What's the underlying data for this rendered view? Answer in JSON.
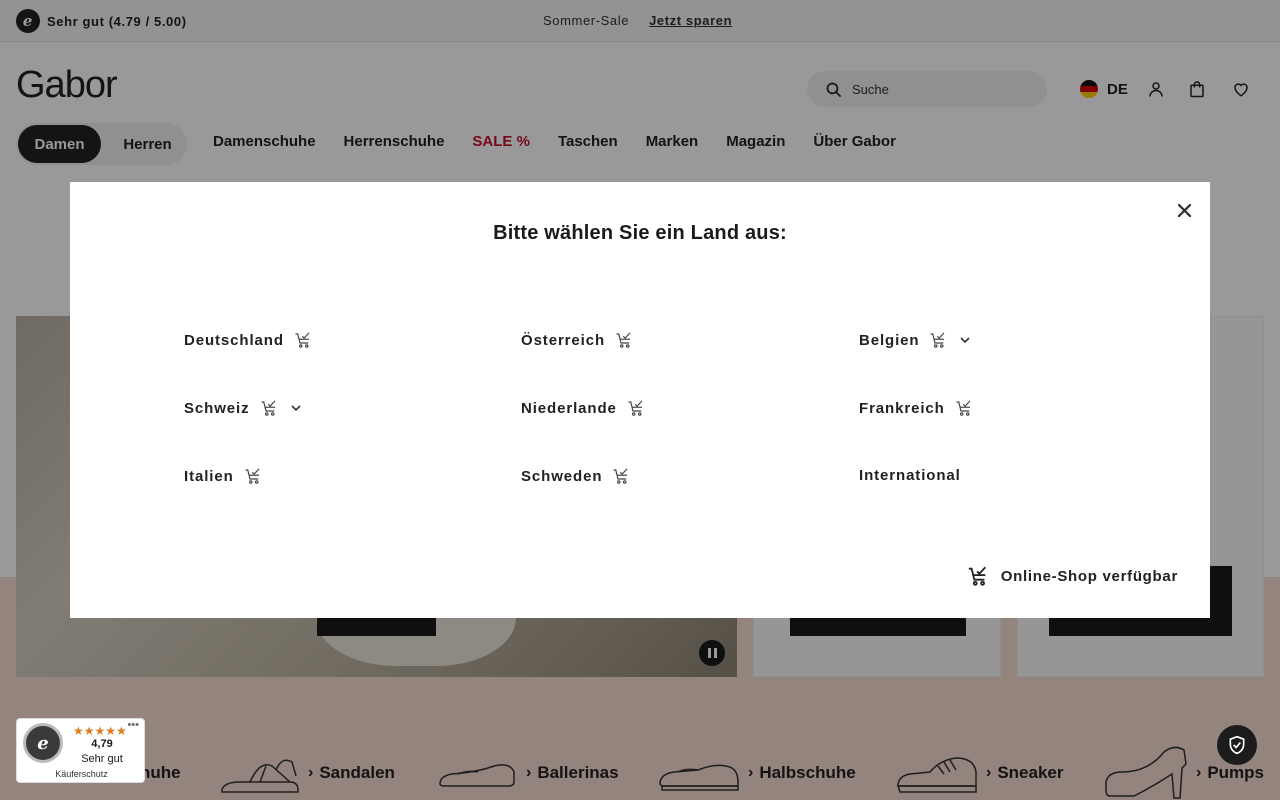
{
  "topbar": {
    "rating_text": "Sehr gut (4.79 / 5.00)",
    "promo_label": "Sommer-Sale",
    "promo_cta": "Jetzt sparen"
  },
  "header": {
    "logo": "Gabor",
    "search_placeholder": "Suche",
    "language": "DE"
  },
  "gender_toggle": {
    "active": "Damen",
    "inactive": "Herren"
  },
  "nav": {
    "items": [
      "Damenschuhe",
      "Herrenschuhe",
      "SALE %",
      "Taschen",
      "Marken",
      "Magazin",
      "Über Gabor"
    ]
  },
  "modal": {
    "title": "Bitte wählen Sie ein Land aus:",
    "countries": [
      {
        "name": "Deutschland",
        "shop": true,
        "expandable": false
      },
      {
        "name": "Österreich",
        "shop": true,
        "expandable": false
      },
      {
        "name": "Belgien",
        "shop": true,
        "expandable": true
      },
      {
        "name": "Schweiz",
        "shop": true,
        "expandable": true
      },
      {
        "name": "Niederlande",
        "shop": true,
        "expandable": false
      },
      {
        "name": "Frankreich",
        "shop": true,
        "expandable": false
      },
      {
        "name": "Italien",
        "shop": true,
        "expandable": false
      },
      {
        "name": "Schweden",
        "shop": true,
        "expandable": false
      },
      {
        "name": "International",
        "shop": false,
        "expandable": false
      }
    ],
    "legend": "Online-Shop verfügbar"
  },
  "categories": [
    {
      "label": "Sandalen"
    },
    {
      "label": "Ballerinas"
    },
    {
      "label": "Halbschuhe"
    },
    {
      "label": "Sneaker"
    },
    {
      "label": "Pumps"
    },
    {
      "label": "huhe"
    }
  ],
  "trusted_badge": {
    "score": "4,79",
    "label": "Sehr gut",
    "footer": "Käuferschutz",
    "stars": 5
  },
  "icons": {
    "rating": "trusted-shops-e-icon",
    "search": "search-icon",
    "account": "user-icon",
    "bag": "shopping-bag-icon",
    "wishlist": "heart-icon",
    "close": "close-icon",
    "cart": "cart-check-icon",
    "expand": "chevron-down-icon",
    "pause": "pause-icon",
    "shield": "shield-check-icon"
  },
  "colors": {
    "sale": "#c8102e",
    "primary": "#1a1a1a",
    "accent_peach": "#f5ddd0",
    "star": "#e07a1f"
  }
}
